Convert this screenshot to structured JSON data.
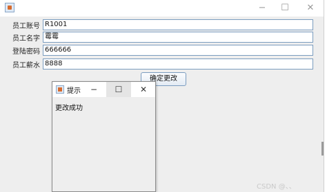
{
  "window": {
    "minimize": "−",
    "maximize": "☐",
    "close": "✕"
  },
  "form": {
    "fields": [
      {
        "label": "员工账号",
        "value": "R1001"
      },
      {
        "label": "员工名字",
        "value": "霉霉"
      },
      {
        "label": "登陆密码",
        "value": "666666"
      },
      {
        "label": "员工薪水",
        "value": "8888"
      }
    ],
    "confirm_label": "确定更改"
  },
  "dialog": {
    "title": "提示",
    "minimize": "−",
    "maximize": "☐",
    "close": "✕",
    "message": "更改成功"
  },
  "watermark": "CSDN @、、"
}
